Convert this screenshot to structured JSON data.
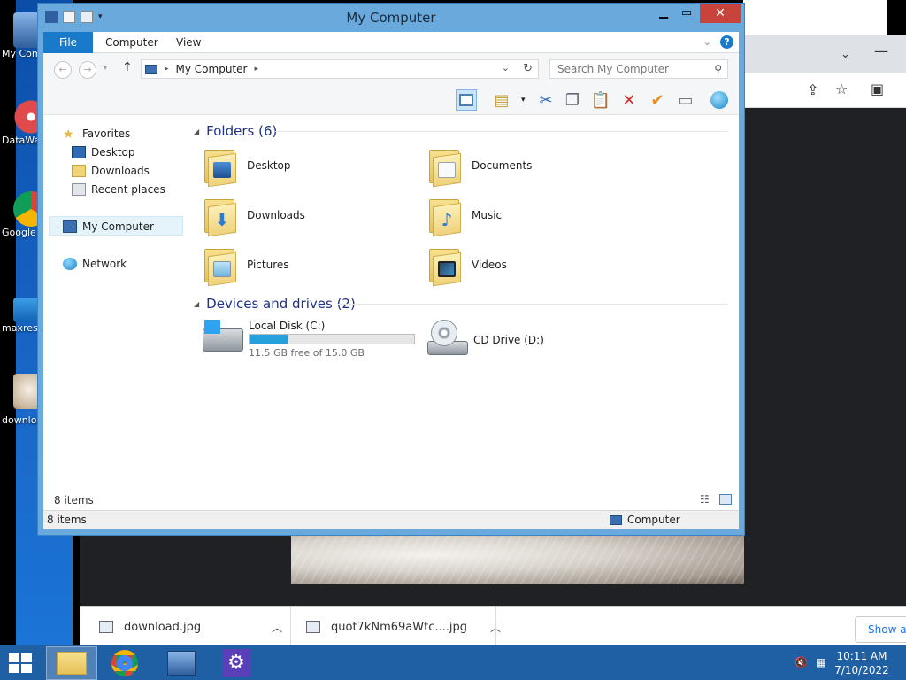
{
  "desktop": {
    "icons": [
      {
        "label": "My Computer"
      },
      {
        "label": "DataWave"
      },
      {
        "label": "Google Chrome"
      },
      {
        "label": "maxresdefault"
      },
      {
        "label": "download"
      }
    ]
  },
  "window": {
    "title": "My Computer",
    "ribbon": {
      "file": "File",
      "computer": "Computer",
      "view": "View",
      "help": "?"
    },
    "address": {
      "path": "My Computer",
      "search_placeholder": "Search My Computer"
    },
    "nav": {
      "favorites": "Favorites",
      "desktop": "Desktop",
      "downloads": "Downloads",
      "recent": "Recent places",
      "my_computer": "My Computer",
      "network": "Network"
    },
    "folders_header": "Folders (6)",
    "folders": [
      {
        "name": "Desktop"
      },
      {
        "name": "Documents"
      },
      {
        "name": "Downloads"
      },
      {
        "name": "Music"
      },
      {
        "name": "Pictures"
      },
      {
        "name": "Videos"
      }
    ],
    "drives_header": "Devices and drives (2)",
    "drives": [
      {
        "name": "Local Disk (C:)",
        "free": "11.5 GB free of 15.0 GB",
        "used_fraction": 0.233
      },
      {
        "name": "CD Drive (D:)"
      }
    ],
    "status": {
      "items_count": "8 items",
      "items_count_bottom": "8 items",
      "location": "Computer"
    }
  },
  "browser": {
    "downloads": [
      {
        "name": "download.jpg"
      },
      {
        "name": "quot7kNm69aWtc....jpg"
      }
    ],
    "show_all": "Show all"
  },
  "taskbar": {
    "time": "10:11 AM",
    "date": "7/10/2022"
  },
  "colors": {
    "accent": "#1979ca",
    "progress": "#26a0da",
    "close": "#c7433b",
    "taskbar": "#1f5fa3"
  }
}
